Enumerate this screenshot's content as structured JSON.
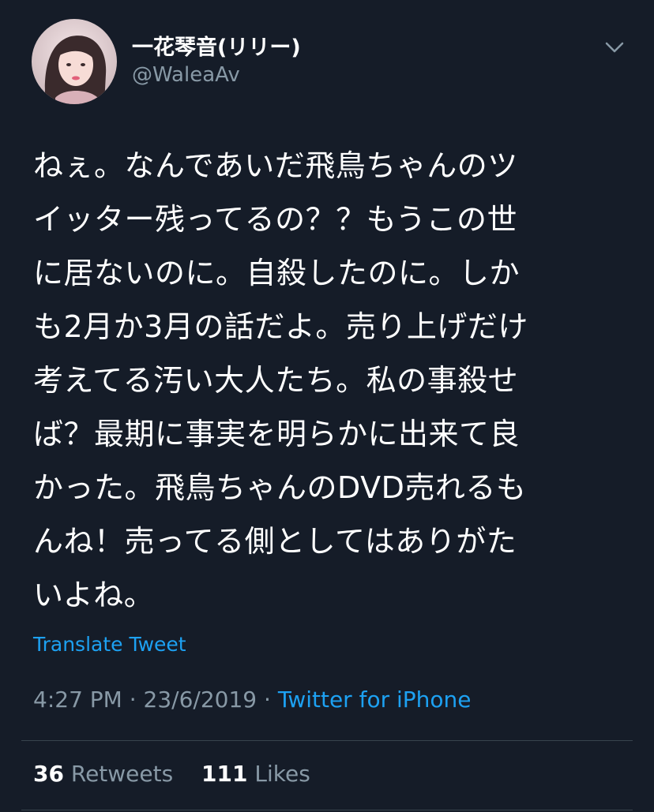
{
  "user": {
    "display_name": "一花琴音(リリー)",
    "handle": "@WaleaAv",
    "avatar_icon": "profile-photo"
  },
  "menu": {
    "icon": "chevron-down-icon"
  },
  "tweet": {
    "text": "ねぇ。なんであいだ飛鳥ちゃんのツ\nイッター残ってるの？？もうこの世\nに居ないのに。自殺したのに。しか\nも2月か3月の話だよ。売り上げだけ\n考えてる汚い大人たち。私の事殺せ\nば？最期に事実を明らかに出来て良\nかった。飛鳥ちゃんのDVD売れるも\nんね！売ってる側としてはありがた\nいよね。",
    "translate_label": "Translate Tweet",
    "time": "4:27 PM",
    "date": "23/6/2019",
    "separator": "·",
    "source": "Twitter for iPhone"
  },
  "stats": {
    "retweets_count": "36",
    "retweets_label": "Retweets",
    "likes_count": "111",
    "likes_label": "Likes"
  },
  "colors": {
    "background": "#151c28",
    "text": "#ffffff",
    "secondary": "#8899a6",
    "accent": "#1da1f2",
    "divider": "#38444d"
  }
}
